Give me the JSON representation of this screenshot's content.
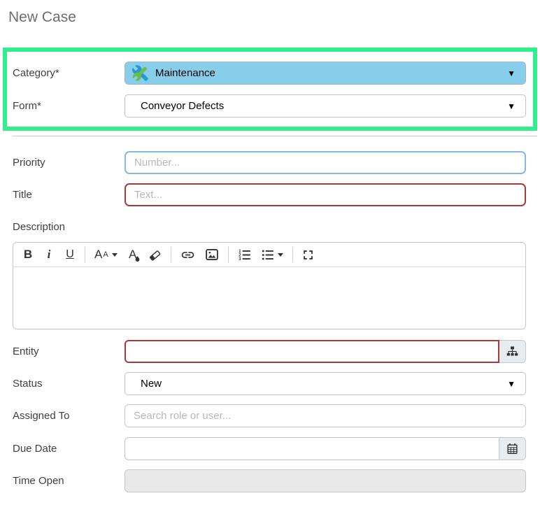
{
  "page": {
    "title": "New Case"
  },
  "colors": {
    "highlight_green": "#33ee8e",
    "category_bg": "#87ceeb",
    "info_border": "#84b7e6",
    "error_border": "#a43a3a",
    "disabled_bg": "#e9e9e9",
    "label_text": "#3f3f3f",
    "title_text": "#6d6d6d"
  },
  "form": {
    "category": {
      "label": "Category*",
      "value": "Maintenance",
      "icon": "maintenance-tools-icon"
    },
    "form_type": {
      "label": "Form*",
      "value": "Conveyor Defects"
    },
    "priority": {
      "label": "Priority",
      "value": "",
      "placeholder": "Number..."
    },
    "title": {
      "label": "Title",
      "value": "",
      "placeholder": "Text..."
    },
    "description": {
      "label": "Description",
      "value": ""
    },
    "entity": {
      "label": "Entity",
      "value": ""
    },
    "status": {
      "label": "Status",
      "value": "New"
    },
    "assigned_to": {
      "label": "Assigned To",
      "value": "",
      "placeholder": "Search role or user..."
    },
    "due_date": {
      "label": "Due Date",
      "value": ""
    },
    "time_open": {
      "label": "Time Open",
      "value": ""
    }
  },
  "editor_toolbar": {
    "bold": "B",
    "italic": "i",
    "underline": "U",
    "font_size_big": "A",
    "font_size_small": "A",
    "font_color_letter": "A",
    "buttons": [
      "bold",
      "italic",
      "underline",
      "font-size",
      "font-color",
      "remove-format",
      "link",
      "image",
      "ordered-list",
      "unordered-list",
      "fullscreen"
    ]
  },
  "icons": {
    "dropdown_arrow": "▼"
  }
}
